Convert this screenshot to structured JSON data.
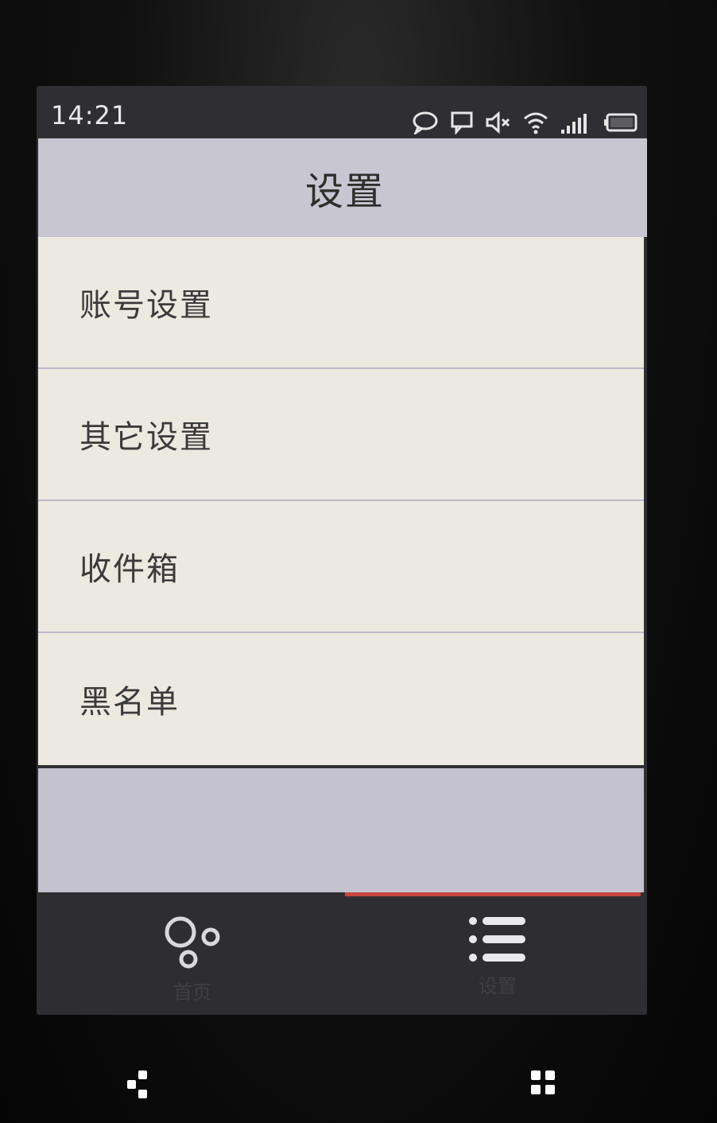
{
  "status_bar": {
    "time": "14:21",
    "icons": [
      "chat-bubble-icon",
      "message-icon",
      "mute-icon",
      "wifi-icon",
      "signal-icon",
      "battery-icon"
    ]
  },
  "header": {
    "title": "设置"
  },
  "menu": {
    "items": [
      {
        "label": "账号设置"
      },
      {
        "label": "其它设置"
      },
      {
        "label": "收件箱"
      },
      {
        "label": "黑名单"
      }
    ]
  },
  "tab_bar": {
    "tabs": [
      {
        "label": "首页",
        "icon": "bubbles-icon",
        "active": false
      },
      {
        "label": "设置",
        "icon": "list-icon",
        "active": true
      }
    ],
    "active_color": "#c9453f"
  },
  "colors": {
    "header_bg": "#c7c6d1",
    "list_bg": "#ece9e0",
    "divider": "#bab8c8",
    "tab_bar_bg": "#2e2e32"
  },
  "nav_buttons": [
    "share-icon",
    "apps-grid-icon"
  ]
}
